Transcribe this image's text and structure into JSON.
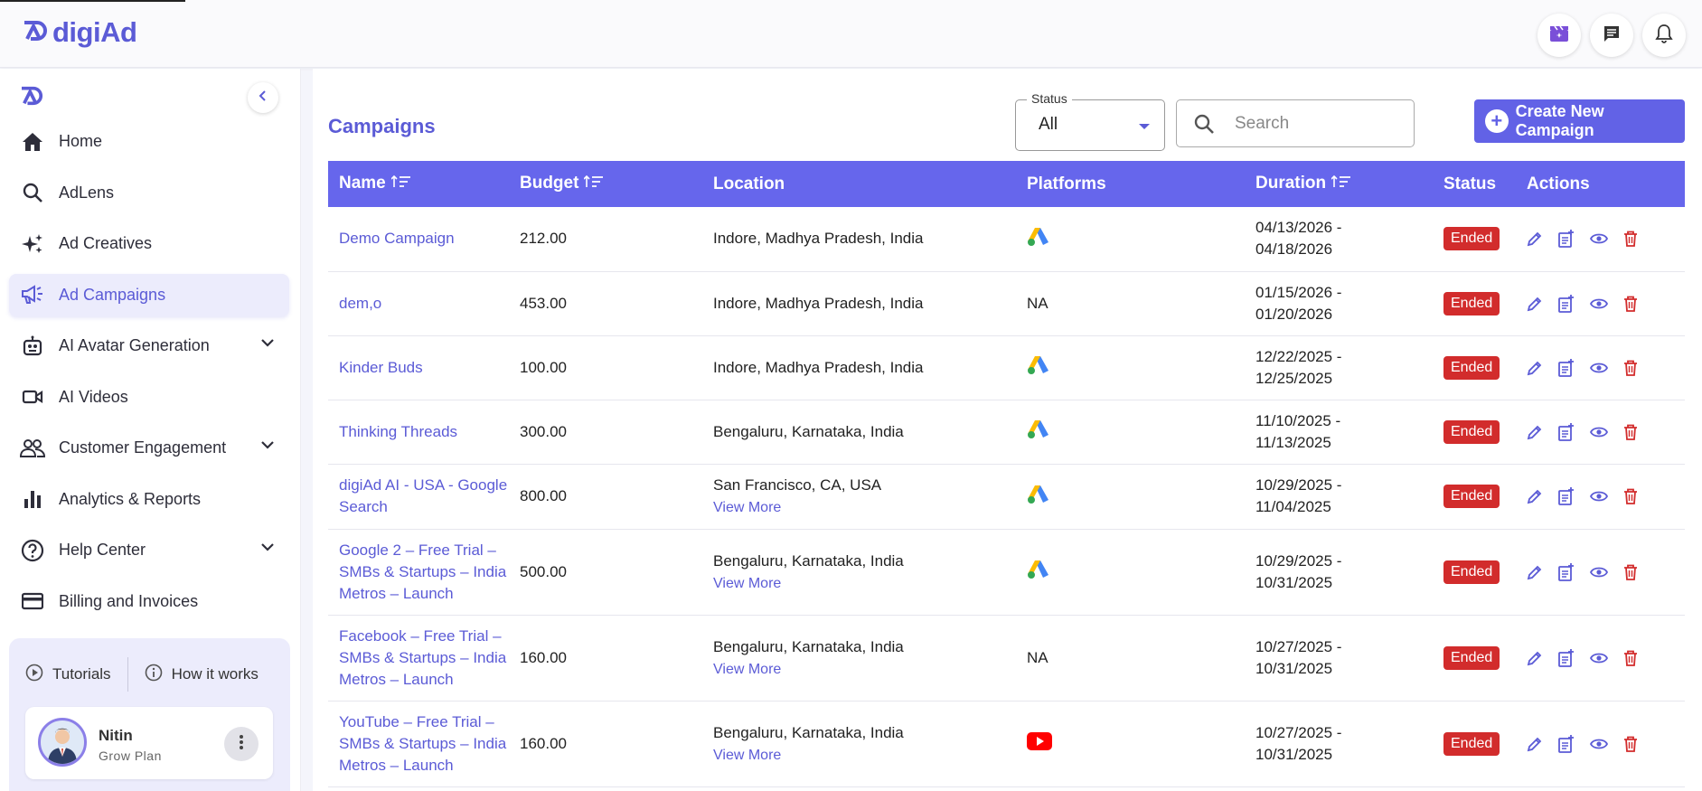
{
  "app": {
    "brand": "digiAd"
  },
  "sidebar": {
    "items": [
      {
        "label": "Home",
        "icon": "home-icon"
      },
      {
        "label": "AdLens",
        "icon": "search-icon"
      },
      {
        "label": "Ad Creatives",
        "icon": "sparkle-icon"
      },
      {
        "label": "Ad Campaigns",
        "icon": "megaphone-icon",
        "active": true
      },
      {
        "label": "AI Avatar Generation",
        "icon": "robot-icon",
        "expandable": true
      },
      {
        "label": "AI Videos",
        "icon": "video-icon"
      },
      {
        "label": "Customer Engagement",
        "icon": "people-icon",
        "expandable": true
      },
      {
        "label": "Analytics & Reports",
        "icon": "bar-chart-icon"
      },
      {
        "label": "Help Center",
        "icon": "help-icon",
        "expandable": true
      },
      {
        "label": "Billing and Invoices",
        "icon": "card-icon"
      }
    ],
    "tutorials_label": "Tutorials",
    "how_it_works_label": "How it works",
    "user": {
      "name": "Nitin",
      "plan": "Grow Plan"
    }
  },
  "main": {
    "title": "Campaigns",
    "status_filter": {
      "label": "Status",
      "value": "All"
    },
    "search": {
      "placeholder": "Search"
    },
    "create_button": "Create New Campaign",
    "columns": [
      "Name",
      "Budget",
      "Location",
      "Platforms",
      "Duration",
      "Status",
      "Actions"
    ],
    "rows": [
      {
        "name": "Demo Campaign",
        "budget": "212.00",
        "location": "Indore, Madhya Pradesh, India",
        "view_more": "",
        "platform": "google-ads",
        "platform_text": "",
        "start": "04/13/2026 -",
        "end": "04/18/2026",
        "status": "Ended"
      },
      {
        "name": "dem,o",
        "budget": "453.00",
        "location": "Indore, Madhya Pradesh, India",
        "view_more": "",
        "platform": "none",
        "platform_text": "NA",
        "start": "01/15/2026 -",
        "end": "01/20/2026",
        "status": "Ended"
      },
      {
        "name": "Kinder Buds",
        "budget": "100.00",
        "location": "Indore, Madhya Pradesh, India",
        "view_more": "",
        "platform": "google-ads",
        "platform_text": "",
        "start": "12/22/2025 -",
        "end": "12/25/2025",
        "status": "Ended"
      },
      {
        "name": "Thinking Threads",
        "budget": "300.00",
        "location": "Bengaluru, Karnataka, India",
        "view_more": "",
        "platform": "google-ads",
        "platform_text": "",
        "start": "11/10/2025 -",
        "end": "11/13/2025",
        "status": "Ended"
      },
      {
        "name": "digiAd AI - USA - Google Search",
        "budget": "800.00",
        "location": "San Francisco, CA, USA",
        "view_more": "View More",
        "platform": "google-ads",
        "platform_text": "",
        "start": "10/29/2025 -",
        "end": "11/04/2025",
        "status": "Ended"
      },
      {
        "name": "Google 2 – Free Trial – SMBs & Startups – India Metros – Launch",
        "budget": "500.00",
        "location": "Bengaluru, Karnataka, India",
        "view_more": "View More",
        "platform": "google-ads",
        "platform_text": "",
        "start": "10/29/2025 -",
        "end": "10/31/2025",
        "status": "Ended"
      },
      {
        "name": "Facebook – Free Trial – SMBs & Startups – India Metros – Launch",
        "budget": "160.00",
        "location": "Bengaluru, Karnataka, India",
        "view_more": "View More",
        "platform": "none",
        "platform_text": "NA",
        "start": "10/27/2025 -",
        "end": "10/31/2025",
        "status": "Ended"
      },
      {
        "name": "YouTube – Free Trial – SMBs & Startups – India Metros – Launch",
        "budget": "160.00",
        "location": "Bengaluru, Karnataka, India",
        "view_more": "View More",
        "platform": "youtube",
        "platform_text": "",
        "start": "10/27/2025 -",
        "end": "10/31/2025",
        "status": "Ended"
      }
    ]
  },
  "colors": {
    "accent": "#6666ec",
    "ended": "#d22c2c",
    "link": "#5b5bd6"
  }
}
